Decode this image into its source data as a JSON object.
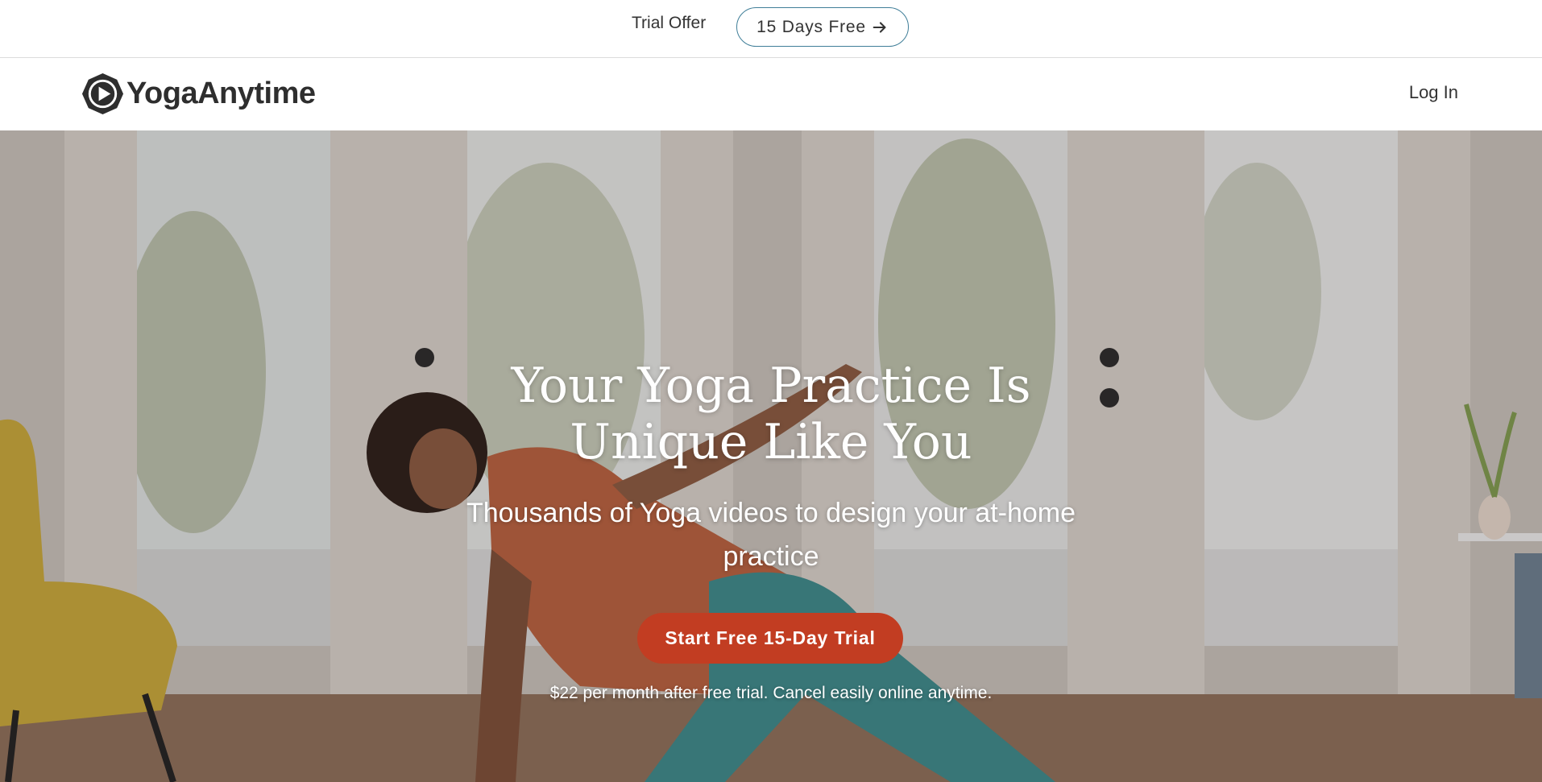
{
  "promo": {
    "label": "Trial Offer",
    "button_label": "15 Days Free",
    "button_icon": "arrow-right-icon",
    "accent_color": "#3f7e98"
  },
  "header": {
    "logo_text": "YogaAnytime",
    "logo_icon": "play-circle-logo-icon",
    "login_label": "Log In"
  },
  "hero": {
    "title": "Your Yoga Practice Is Unique Like You",
    "subtitle": "Thousands of Yoga videos to design your at-home practice",
    "cta_label": "Start Free 15-Day Trial",
    "cta_color": "#c23d22",
    "price_note": "$22 per month after free trial. Cancel easily online anytime."
  }
}
